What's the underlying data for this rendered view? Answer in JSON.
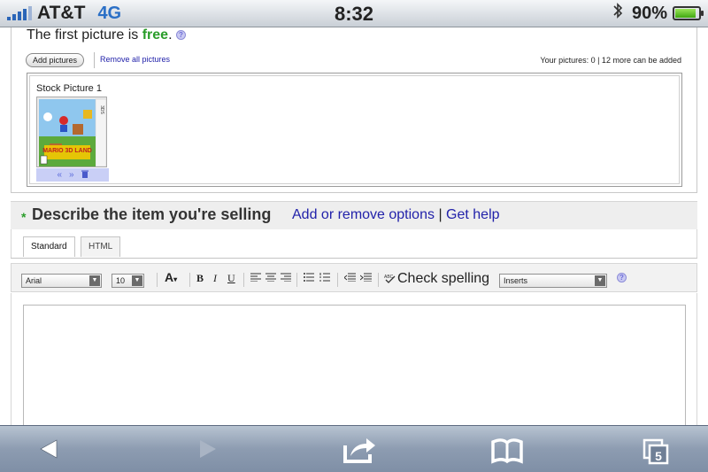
{
  "status_bar": {
    "carrier": "AT&T",
    "network": "4G",
    "time": "8:32",
    "battery_percent": "90%",
    "battery_level": 0.9,
    "icons": [
      "signal-bars-icon",
      "bluetooth-icon",
      "battery-icon"
    ]
  },
  "pictures": {
    "first_picture_prefix": "The first picture is ",
    "first_picture_free": "free",
    "first_picture_suffix": ".",
    "add_button": "Add pictures",
    "remove_all": "Remove all pictures",
    "count_text": "Your pictures: 0 | 12 more can be added",
    "stock_label": "Stock Picture 1",
    "thumbnail_text": "MARIO 3D LAND",
    "thumbnail_brand": "3DS",
    "controls": [
      "«",
      "»",
      "🗑"
    ]
  },
  "describe": {
    "required_mark": "*",
    "title": "Describe the item you're selling",
    "add_remove": "Add or remove options",
    "separator": "|",
    "help": "Get help"
  },
  "editor": {
    "tabs": [
      {
        "label": "Standard",
        "active": true
      },
      {
        "label": "HTML",
        "active": false
      }
    ],
    "font_select": "Arial",
    "size_select": "10",
    "bold": "B",
    "italic": "I",
    "underline": "U",
    "check_spelling": "Check spelling",
    "inserts_select": "Inserts",
    "content": ""
  },
  "browser_toolbar": {
    "tab_count": "5",
    "buttons": [
      "back-icon",
      "forward-icon",
      "share-icon",
      "bookmarks-icon",
      "tabs-icon"
    ]
  },
  "colors": {
    "free_green": "#2a9d2a",
    "link_blue": "#2222aa",
    "network_blue": "#2a6fc6"
  }
}
